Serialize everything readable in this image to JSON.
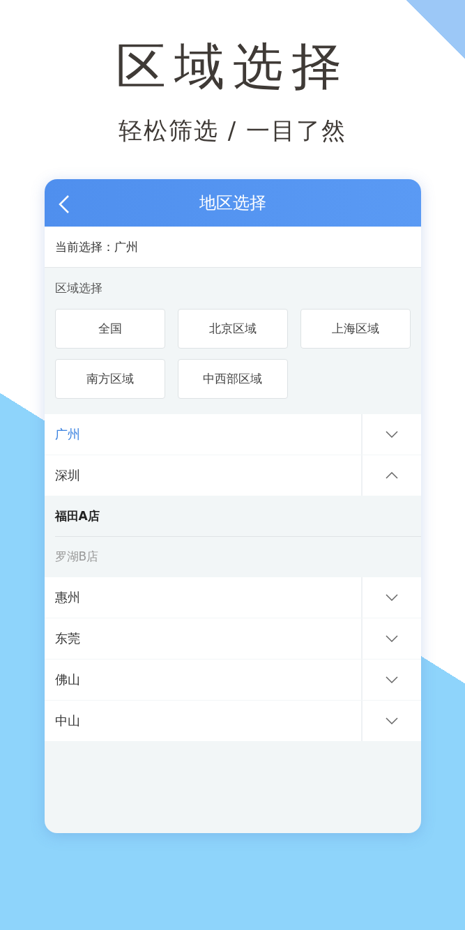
{
  "headline": "区域选择",
  "subtitle": "轻松筛选 / 一目了然",
  "panel": {
    "title": "地区选择",
    "current_selection": "当前选择：广州",
    "region_section": {
      "label": "区域选择",
      "options": [
        "全国",
        "北京区域",
        "上海区域",
        "南方区域",
        "中西部区域"
      ]
    },
    "cities": [
      {
        "name": "广州",
        "selected": true,
        "expanded": false
      },
      {
        "name": "深圳",
        "selected": false,
        "expanded": true,
        "stores": [
          {
            "name": "福田A店",
            "disabled": false
          },
          {
            "name": "罗湖B店",
            "disabled": true
          }
        ]
      },
      {
        "name": "惠州",
        "selected": false,
        "expanded": false
      },
      {
        "name": "东莞",
        "selected": false,
        "expanded": false
      },
      {
        "name": "佛山",
        "selected": false,
        "expanded": false
      },
      {
        "name": "中山",
        "selected": false,
        "expanded": false
      }
    ]
  }
}
